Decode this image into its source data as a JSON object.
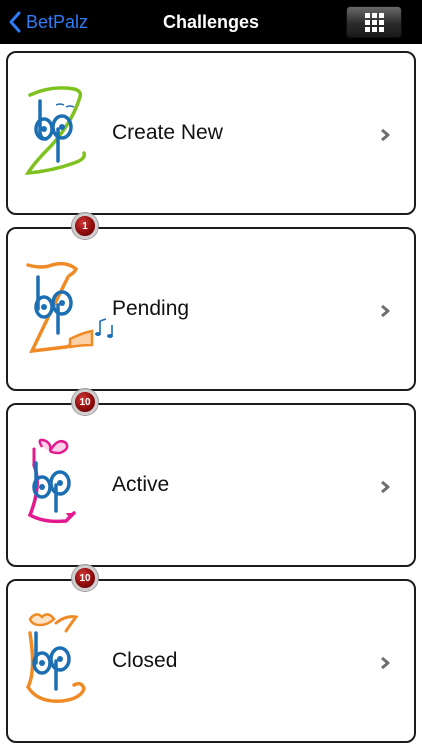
{
  "navbar": {
    "back_label": "BetPalz",
    "title": "Challenges",
    "back_color": "#2f7cf6"
  },
  "menu": {
    "items": [
      {
        "label": "Create New",
        "badge": null,
        "accent": "#7dc21e",
        "icon": "create-new-logo-icon"
      },
      {
        "label": "Pending",
        "badge": "1",
        "accent": "#f08a24",
        "icon": "pending-logo-icon"
      },
      {
        "label": "Active",
        "badge": "10",
        "accent": "#e3198f",
        "icon": "active-logo-icon"
      },
      {
        "label": "Closed",
        "badge": "10",
        "accent": "#f08a24",
        "icon": "closed-logo-icon"
      }
    ]
  },
  "colors": {
    "logo_blue": "#1d6fb3",
    "badge_red": "#a31212"
  }
}
